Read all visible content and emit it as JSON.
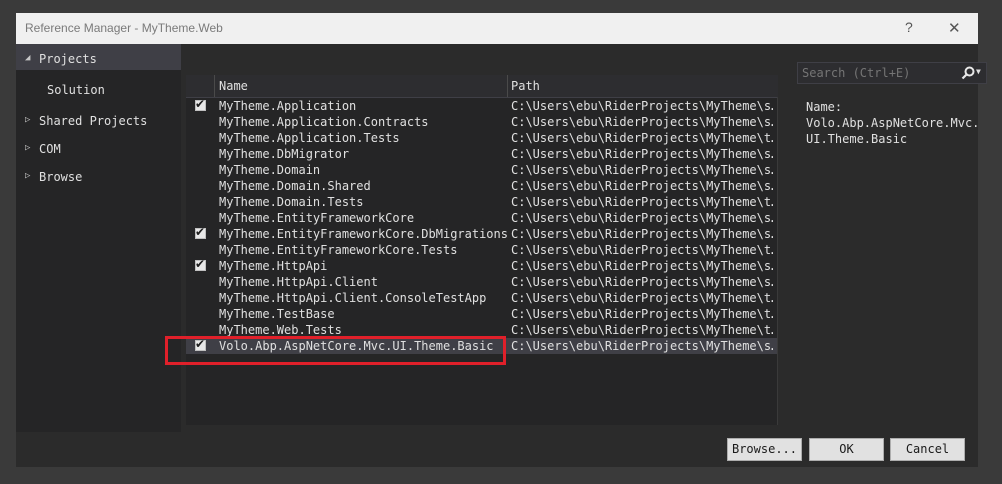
{
  "window": {
    "title": "Reference Manager - MyTheme.Web",
    "help_label": "?",
    "close_label": "✕"
  },
  "sidebar": {
    "items": [
      {
        "label": "Projects",
        "arrow": "◢",
        "expanded": true,
        "selected": true
      },
      {
        "label": "Solution",
        "arrow": "",
        "child": true
      },
      {
        "label": "Shared Projects",
        "arrow": "▷"
      },
      {
        "label": "COM",
        "arrow": "▷"
      },
      {
        "label": "Browse",
        "arrow": "▷"
      }
    ]
  },
  "grid": {
    "columns": {
      "name": "Name",
      "path": "Path"
    },
    "rows": [
      {
        "checked": true,
        "name": "MyTheme.Application",
        "path": "C:\\Users\\ebu\\RiderProjects\\MyTheme\\s…"
      },
      {
        "checked": false,
        "name": "MyTheme.Application.Contracts",
        "path": "C:\\Users\\ebu\\RiderProjects\\MyTheme\\s…"
      },
      {
        "checked": false,
        "name": "MyTheme.Application.Tests",
        "path": "C:\\Users\\ebu\\RiderProjects\\MyTheme\\t…"
      },
      {
        "checked": false,
        "name": "MyTheme.DbMigrator",
        "path": "C:\\Users\\ebu\\RiderProjects\\MyTheme\\s…"
      },
      {
        "checked": false,
        "name": "MyTheme.Domain",
        "path": "C:\\Users\\ebu\\RiderProjects\\MyTheme\\s…"
      },
      {
        "checked": false,
        "name": "MyTheme.Domain.Shared",
        "path": "C:\\Users\\ebu\\RiderProjects\\MyTheme\\s…"
      },
      {
        "checked": false,
        "name": "MyTheme.Domain.Tests",
        "path": "C:\\Users\\ebu\\RiderProjects\\MyTheme\\t…"
      },
      {
        "checked": false,
        "name": "MyTheme.EntityFrameworkCore",
        "path": "C:\\Users\\ebu\\RiderProjects\\MyTheme\\s…"
      },
      {
        "checked": true,
        "name": "MyTheme.EntityFrameworkCore.DbMigrations",
        "path": "C:\\Users\\ebu\\RiderProjects\\MyTheme\\s…"
      },
      {
        "checked": false,
        "name": "MyTheme.EntityFrameworkCore.Tests",
        "path": "C:\\Users\\ebu\\RiderProjects\\MyTheme\\t…"
      },
      {
        "checked": true,
        "name": "MyTheme.HttpApi",
        "path": "C:\\Users\\ebu\\RiderProjects\\MyTheme\\s…"
      },
      {
        "checked": false,
        "name": "MyTheme.HttpApi.Client",
        "path": "C:\\Users\\ebu\\RiderProjects\\MyTheme\\s…"
      },
      {
        "checked": false,
        "name": "MyTheme.HttpApi.Client.ConsoleTestApp",
        "path": "C:\\Users\\ebu\\RiderProjects\\MyTheme\\t…"
      },
      {
        "checked": false,
        "name": "MyTheme.TestBase",
        "path": "C:\\Users\\ebu\\RiderProjects\\MyTheme\\t…"
      },
      {
        "checked": false,
        "name": "MyTheme.Web.Tests",
        "path": "C:\\Users\\ebu\\RiderProjects\\MyTheme\\t…"
      },
      {
        "checked": true,
        "name": "Volo.Abp.AspNetCore.Mvc.UI.Theme.Basic",
        "path": "C:\\Users\\ebu\\RiderProjects\\MyTheme\\s…",
        "selected": true
      }
    ]
  },
  "search": {
    "placeholder": "Search (Ctrl+E)"
  },
  "details": {
    "name_label": "Name:",
    "name_value": "Volo.Abp.AspNetCore.Mvc.UI.Theme.Basic"
  },
  "buttons": {
    "browse": "Browse...",
    "ok": "OK",
    "cancel": "Cancel"
  },
  "colors": {
    "highlight": "#e0202a",
    "background": "#2b2b2b",
    "titlebar": "#f0f0f0"
  }
}
